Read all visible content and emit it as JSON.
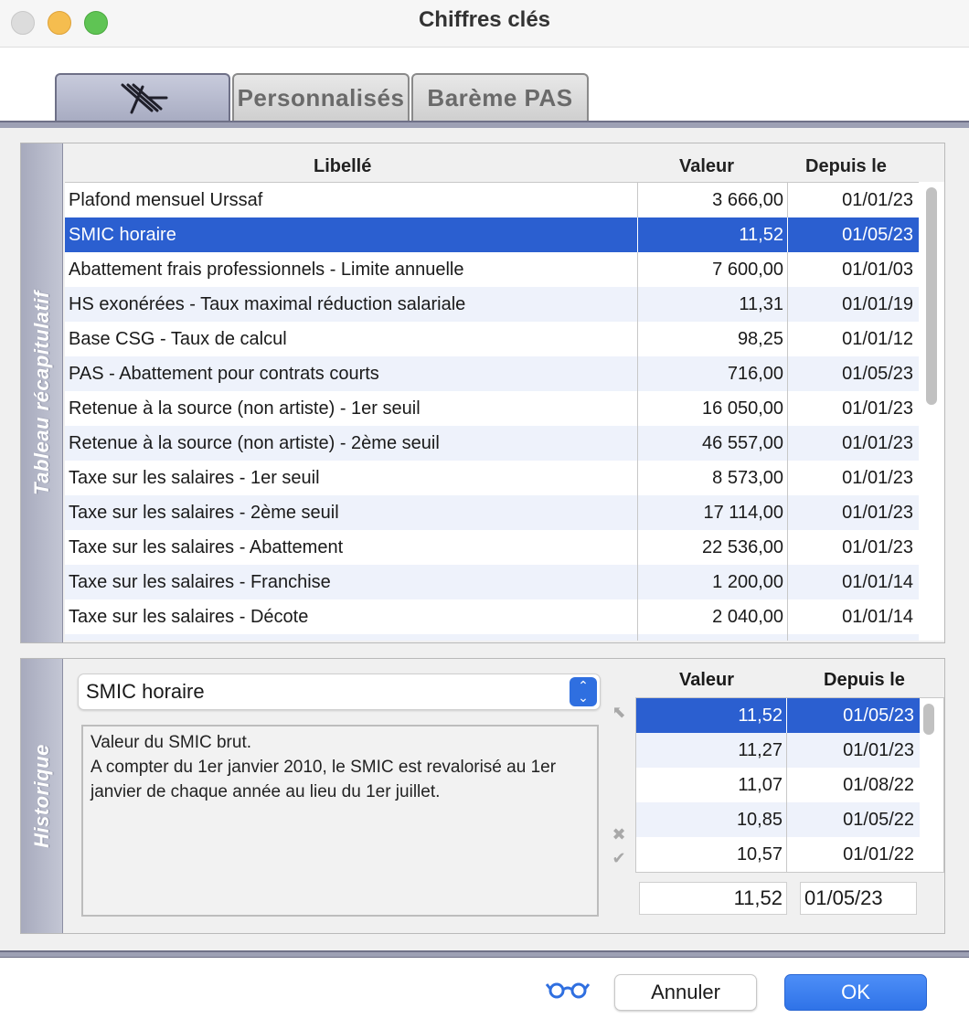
{
  "window": {
    "title": "Chiffres clés"
  },
  "tabs": [
    {
      "label": "",
      "icon": "beach-chair-icon",
      "active": true
    },
    {
      "label": "Personnalisés",
      "active": false
    },
    {
      "label": "Barème PAS",
      "active": false
    }
  ],
  "summary": {
    "section_label": "Tableau récapitulatif",
    "columns": {
      "libelle": "Libellé",
      "valeur": "Valeur",
      "depuis": "Depuis le"
    },
    "rows": [
      {
        "libelle": "Plafond mensuel Urssaf",
        "valeur": "3 666,00",
        "depuis": "01/01/23"
      },
      {
        "libelle": "SMIC horaire",
        "valeur": "11,52",
        "depuis": "01/05/23",
        "selected": true
      },
      {
        "libelle": "Abattement frais professionnels - Limite annuelle",
        "valeur": "7 600,00",
        "depuis": "01/01/03"
      },
      {
        "libelle": "HS exonérées - Taux maximal réduction salariale",
        "valeur": "11,31",
        "depuis": "01/01/19"
      },
      {
        "libelle": "Base CSG - Taux de calcul",
        "valeur": "98,25",
        "depuis": "01/01/12"
      },
      {
        "libelle": "PAS - Abattement pour contrats courts",
        "valeur": "716,00",
        "depuis": "01/05/23"
      },
      {
        "libelle": "Retenue à la source (non artiste) - 1er seuil",
        "valeur": "16 050,00",
        "depuis": "01/01/23"
      },
      {
        "libelle": "Retenue à la source (non artiste) - 2ème seuil",
        "valeur": "46 557,00",
        "depuis": "01/01/23"
      },
      {
        "libelle": "Taxe sur les salaires - 1er seuil",
        "valeur": "8 573,00",
        "depuis": "01/01/23"
      },
      {
        "libelle": "Taxe sur les salaires - 2ème seuil",
        "valeur": "17 114,00",
        "depuis": "01/01/23"
      },
      {
        "libelle": "Taxe sur les salaires - Abattement",
        "valeur": "22 536,00",
        "depuis": "01/01/23"
      },
      {
        "libelle": "Taxe sur les salaires - Franchise",
        "valeur": "1 200,00",
        "depuis": "01/01/14"
      },
      {
        "libelle": "Taxe sur les salaires - Décote",
        "valeur": "2 040,00",
        "depuis": "01/01/14"
      }
    ]
  },
  "history": {
    "section_label": "Historique",
    "selected_item": "SMIC horaire",
    "description": "Valeur du SMIC brut.\nA compter du 1er janvier 2010, le SMIC est revalorisé au 1er janvier de chaque année au lieu du 1er juillet.",
    "columns": {
      "valeur": "Valeur",
      "depuis": "Depuis le"
    },
    "rows": [
      {
        "valeur": "11,52",
        "depuis": "01/05/23",
        "selected": true
      },
      {
        "valeur": "11,27",
        "depuis": "01/01/23"
      },
      {
        "valeur": "11,07",
        "depuis": "01/08/22"
      },
      {
        "valeur": "10,85",
        "depuis": "01/05/22"
      },
      {
        "valeur": "10,57",
        "depuis": "01/01/22"
      }
    ],
    "edit_value": "11,52",
    "edit_date": "01/05/23"
  },
  "footer": {
    "cancel_label": "Annuler",
    "ok_label": "OK",
    "preview_icon": "glasses-icon",
    "accent_color": "#2f73e8"
  }
}
